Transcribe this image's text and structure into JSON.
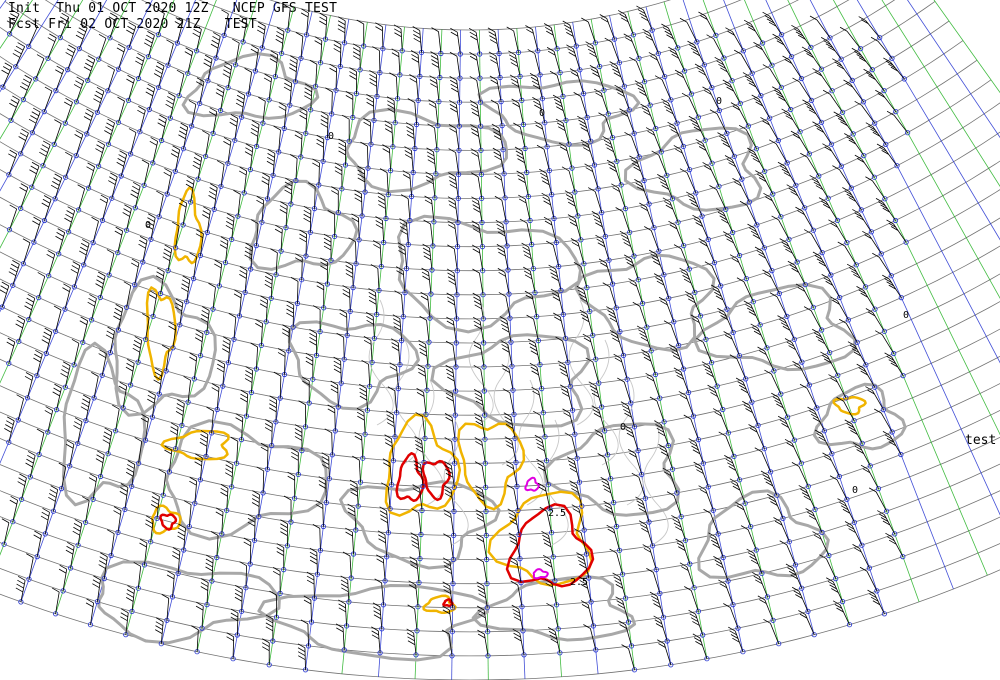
{
  "header": {
    "line1": "Init  Thu 01 OCT 2020 12Z   NCEP GFS TEST",
    "line2": "Fcst Fri 02 OCT 2020 21Z   TEST"
  },
  "side_label": "test",
  "contour_labels": [
    "0",
    "0",
    "0",
    "0",
    "0",
    "0",
    "0",
    "2.5",
    "2.5"
  ],
  "colors": {
    "contour_gray": "#a8a8a8",
    "contour_yellow": "#f0b400",
    "contour_red": "#e00000",
    "contour_magenta": "#e000e0",
    "grid_blue": "#2030d0",
    "grid_green": "#20b020",
    "barb_black": "#000000",
    "coastline": "#c8c8c8"
  },
  "legend_levels": [
    "gray",
    "yellow",
    "red",
    "magenta"
  ]
}
